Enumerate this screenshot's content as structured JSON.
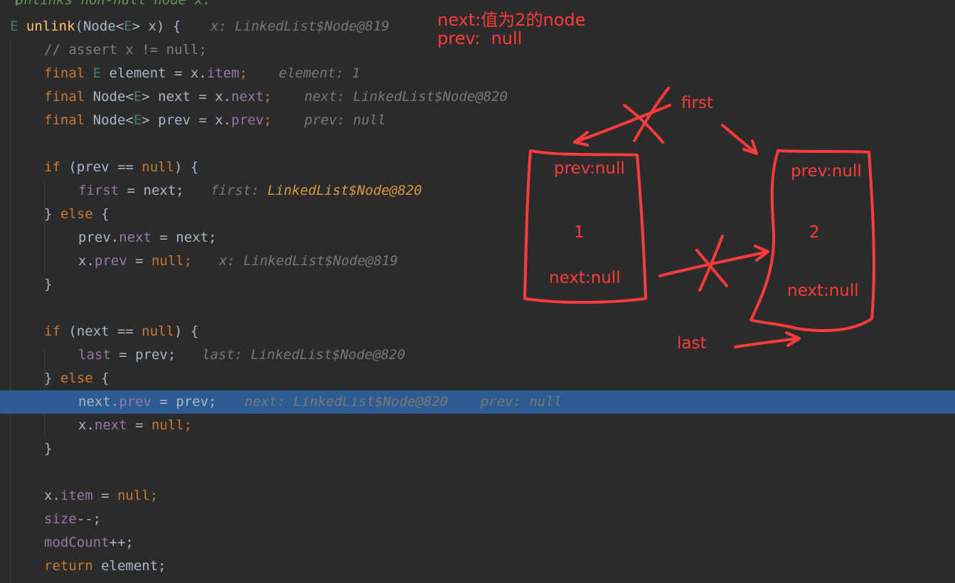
{
  "editor": {
    "top_comment": "Unlinks non-null node x.",
    "lines": [
      {
        "parts": [
          {
            "t": "E ",
            "c": "tp"
          },
          {
            "t": "unlink",
            "c": "fn"
          },
          {
            "t": "(Node<",
            "c": ""
          },
          {
            "t": "E",
            "c": "tp"
          },
          {
            "t": "> x) {",
            "c": ""
          }
        ],
        "hint": "x: LinkedList$Node@819"
      },
      {
        "parts": [
          {
            "t": "// assert x != null;",
            "c": "cm"
          }
        ],
        "hint": ""
      },
      {
        "parts": [
          {
            "t": "final ",
            "c": "kw"
          },
          {
            "t": "E",
            "c": "tp"
          },
          {
            "t": " element = x.",
            "c": ""
          },
          {
            "t": "item",
            "c": "fld"
          },
          {
            "t": ";",
            "c": "kw"
          }
        ],
        "hint": "element: 1"
      },
      {
        "parts": [
          {
            "t": "final ",
            "c": "kw"
          },
          {
            "t": "Node<",
            "c": ""
          },
          {
            "t": "E",
            "c": "tp"
          },
          {
            "t": "> next = x.",
            "c": ""
          },
          {
            "t": "next",
            "c": "fld"
          },
          {
            "t": ";",
            "c": "kw"
          }
        ],
        "hint": "next: LinkedList$Node@820"
      },
      {
        "parts": [
          {
            "t": "final ",
            "c": "kw"
          },
          {
            "t": "Node<",
            "c": ""
          },
          {
            "t": "E",
            "c": "tp"
          },
          {
            "t": "> prev = x.",
            "c": ""
          },
          {
            "t": "prev",
            "c": "fld"
          },
          {
            "t": ";",
            "c": "kw"
          }
        ],
        "hint": "prev: null"
      },
      {
        "parts": [],
        "hint": ""
      },
      {
        "parts": [
          {
            "t": "if ",
            "c": "kw"
          },
          {
            "t": "(prev == ",
            "c": ""
          },
          {
            "t": "null",
            "c": "kw"
          },
          {
            "t": ") {",
            "c": ""
          }
        ],
        "hint": ""
      },
      {
        "parts": [
          {
            "t": "first",
            "c": "fld"
          },
          {
            "t": " = next;",
            "c": ""
          }
        ],
        "hint": "",
        "hint_label": "first: ",
        "hint_value": "LinkedList$Node@820"
      },
      {
        "parts": [
          {
            "t": "} ",
            "c": ""
          },
          {
            "t": "else",
            "c": "kw"
          },
          {
            "t": " {",
            "c": ""
          }
        ],
        "hint": ""
      },
      {
        "parts": [
          {
            "t": "prev.",
            "c": ""
          },
          {
            "t": "next",
            "c": "fld"
          },
          {
            "t": " = next;",
            "c": ""
          }
        ],
        "hint": ""
      },
      {
        "parts": [
          {
            "t": "x.",
            "c": ""
          },
          {
            "t": "prev",
            "c": "fld"
          },
          {
            "t": " = ",
            "c": ""
          },
          {
            "t": "null",
            "c": "kw"
          },
          {
            "t": ";",
            "c": "kw"
          }
        ],
        "hint": "x: LinkedList$Node@819"
      },
      {
        "parts": [
          {
            "t": "}",
            "c": ""
          }
        ],
        "hint": ""
      },
      {
        "parts": [],
        "hint": ""
      },
      {
        "parts": [
          {
            "t": "if ",
            "c": "kw"
          },
          {
            "t": "(next == ",
            "c": ""
          },
          {
            "t": "null",
            "c": "kw"
          },
          {
            "t": ") {",
            "c": ""
          }
        ],
        "hint": ""
      },
      {
        "parts": [
          {
            "t": "last",
            "c": "fld"
          },
          {
            "t": " = prev;",
            "c": ""
          }
        ],
        "hint": "last: LinkedList$Node@820"
      },
      {
        "parts": [
          {
            "t": "} ",
            "c": ""
          },
          {
            "t": "else",
            "c": "kw"
          },
          {
            "t": " {",
            "c": ""
          }
        ],
        "hint": ""
      },
      {
        "parts": [
          {
            "t": "next.",
            "c": ""
          },
          {
            "t": "prev",
            "c": "fld"
          },
          {
            "t": " = prev;",
            "c": ""
          }
        ],
        "hint": "next: LinkedList$Node@820    prev: null"
      },
      {
        "parts": [
          {
            "t": "x.",
            "c": ""
          },
          {
            "t": "next",
            "c": "fld"
          },
          {
            "t": " = ",
            "c": ""
          },
          {
            "t": "null",
            "c": "kw"
          },
          {
            "t": ";",
            "c": "kw"
          }
        ],
        "hint": ""
      },
      {
        "parts": [
          {
            "t": "}",
            "c": ""
          }
        ],
        "hint": ""
      },
      {
        "parts": [],
        "hint": ""
      },
      {
        "parts": [
          {
            "t": "x.",
            "c": ""
          },
          {
            "t": "item",
            "c": "fld"
          },
          {
            "t": " = ",
            "c": ""
          },
          {
            "t": "null",
            "c": "kw"
          },
          {
            "t": ";",
            "c": "kw"
          }
        ],
        "hint": ""
      },
      {
        "parts": [
          {
            "t": "size",
            "c": "fld"
          },
          {
            "t": "--;",
            "c": ""
          }
        ],
        "hint": ""
      },
      {
        "parts": [
          {
            "t": "modCount",
            "c": "fld"
          },
          {
            "t": "++;",
            "c": ""
          }
        ],
        "hint": ""
      },
      {
        "parts": [
          {
            "t": "return ",
            "c": "kw"
          },
          {
            "t": "element;",
            "c": ""
          }
        ],
        "hint": ""
      }
    ]
  },
  "annotation": {
    "note_line1": "next:值为2的node",
    "note_line2": "prev:  null",
    "node1": {
      "prev": "prev:null",
      "value": "1",
      "next": "next:null"
    },
    "node2": {
      "prev": "prev:null",
      "value": "2",
      "next": "next:null"
    },
    "first_label": "first",
    "last_label": "last"
  },
  "colors": {
    "background": "#2b2b2b",
    "highlight": "#2d5c93",
    "annotation_red": "#ff3b3b"
  }
}
